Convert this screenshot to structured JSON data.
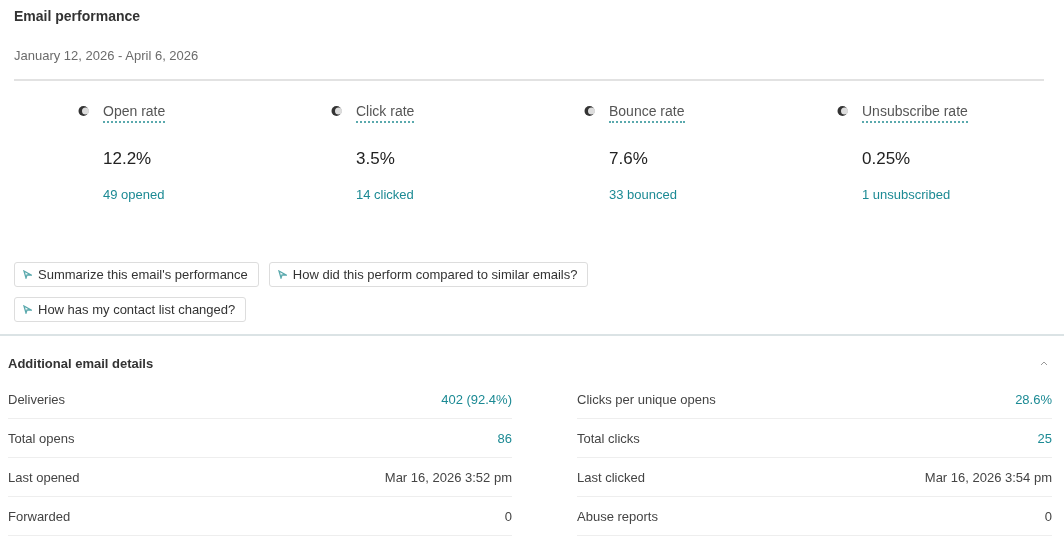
{
  "title": "Email performance",
  "date_range": "January 12, 2026 - April 6, 2026",
  "metrics": [
    {
      "label": "Open rate",
      "value": "12.2%",
      "detail": "49 opened"
    },
    {
      "label": "Click rate",
      "value": "3.5%",
      "detail": "14 clicked"
    },
    {
      "label": "Bounce rate",
      "value": "7.6%",
      "detail": "33 bounced"
    },
    {
      "label": "Unsubscribe rate",
      "value": "0.25%",
      "detail": "1 unsubscribed"
    }
  ],
  "prompts": [
    "Summarize this email's performance",
    "How did this perform compared to similar emails?",
    "How has my contact list changed?"
  ],
  "details": {
    "title": "Additional email details",
    "expanded": true,
    "columns": [
      [
        {
          "label": "Deliveries",
          "value": "402 (92.4%)",
          "link": true
        },
        {
          "label": "Total opens",
          "value": "86",
          "link": true
        },
        {
          "label": "Last opened",
          "value": "Mar 16, 2026 3:52 pm",
          "link": false
        },
        {
          "label": "Forwarded",
          "value": "0",
          "link": false
        }
      ],
      [
        {
          "label": "Clicks per unique opens",
          "value": "28.6%",
          "link": true
        },
        {
          "label": "Total clicks",
          "value": "25",
          "link": true
        },
        {
          "label": "Last clicked",
          "value": "Mar 16, 2026 3:54 pm",
          "link": false
        },
        {
          "label": "Abuse reports",
          "value": "0",
          "link": false
        }
      ]
    ]
  }
}
